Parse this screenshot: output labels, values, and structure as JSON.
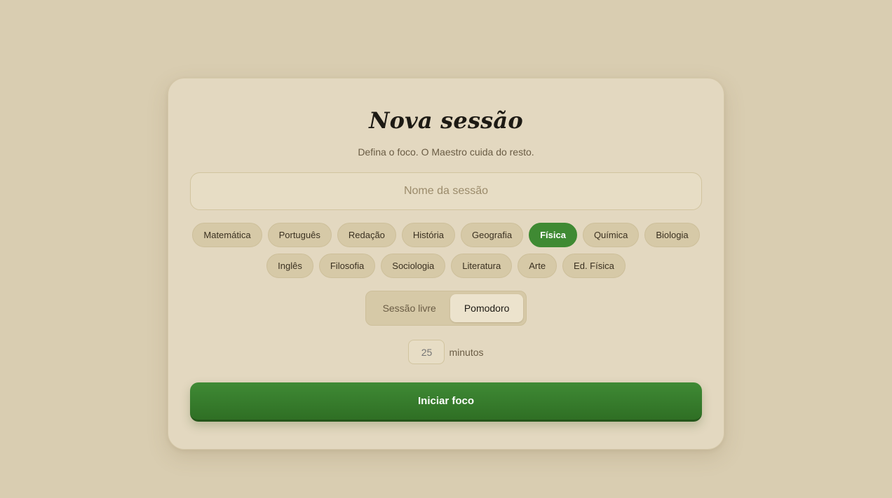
{
  "card": {
    "title": "Nova sessão",
    "subtitle": "Defina o foco. O Maestro cuida do resto."
  },
  "session_name": {
    "value": "",
    "placeholder": "Nome da sessão"
  },
  "subjects": {
    "items": [
      {
        "label": "Matemática",
        "active": false
      },
      {
        "label": "Português",
        "active": false
      },
      {
        "label": "Redação",
        "active": false
      },
      {
        "label": "História",
        "active": false
      },
      {
        "label": "Geografia",
        "active": false
      },
      {
        "label": "Física",
        "active": true
      },
      {
        "label": "Química",
        "active": false
      },
      {
        "label": "Biologia",
        "active": false
      },
      {
        "label": "Inglês",
        "active": false
      },
      {
        "label": "Filosofia",
        "active": false
      },
      {
        "label": "Sociologia",
        "active": false
      },
      {
        "label": "Literatura",
        "active": false
      },
      {
        "label": "Arte",
        "active": false
      },
      {
        "label": "Ed. Física",
        "active": false
      }
    ]
  },
  "mode": {
    "options": [
      {
        "label": "Sessão livre",
        "selected": false
      },
      {
        "label": "Pomodoro",
        "selected": true
      }
    ]
  },
  "duration": {
    "value": "",
    "placeholder": "25",
    "unit_label": "minutos"
  },
  "start_button": {
    "label": "Iniciar foco"
  },
  "colors": {
    "background": "#d9cdb1",
    "card": "#e3d8c0",
    "accent_green": "#3f8a33",
    "chip": "#d6c9a7",
    "text_dark": "#1d1a14",
    "text_muted": "#6a5c44"
  }
}
